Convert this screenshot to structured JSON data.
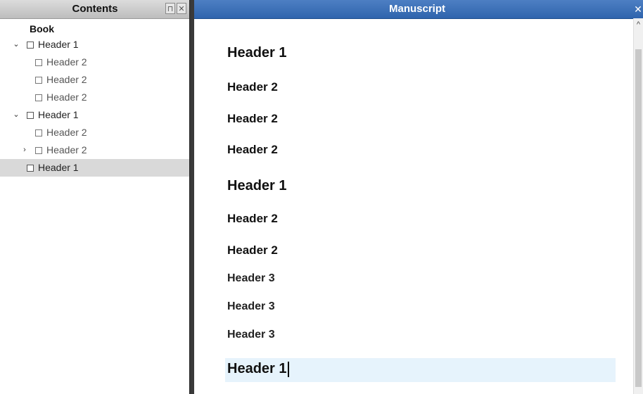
{
  "contents_panel": {
    "title": "Contents",
    "pin_glyph": "⊓",
    "close_glyph": "✕",
    "tree": {
      "root_label": "Book",
      "items": [
        {
          "label": "Header 1",
          "expander": "⌄"
        },
        {
          "label": "Header 2"
        },
        {
          "label": "Header 2"
        },
        {
          "label": "Header 2"
        },
        {
          "label": "Header 1",
          "expander": "⌄"
        },
        {
          "label": "Header 2"
        },
        {
          "label": "Header 2",
          "expander": "›"
        },
        {
          "label": "Header 1"
        }
      ]
    }
  },
  "manuscript_panel": {
    "title": "Manuscript",
    "close_glyph": "✕",
    "scroll_up_glyph": "^",
    "headings": [
      "Header 1",
      "Header 2",
      "Header 2",
      "Header 2",
      "Header 1",
      "Header 2",
      "Header 2",
      "Header 3",
      "Header 3",
      "Header 3",
      "Header 1"
    ]
  },
  "colors": {
    "accent": "#3a6fb8",
    "selection": "#d9d9d9",
    "caret_line": "#e6f3fc"
  }
}
